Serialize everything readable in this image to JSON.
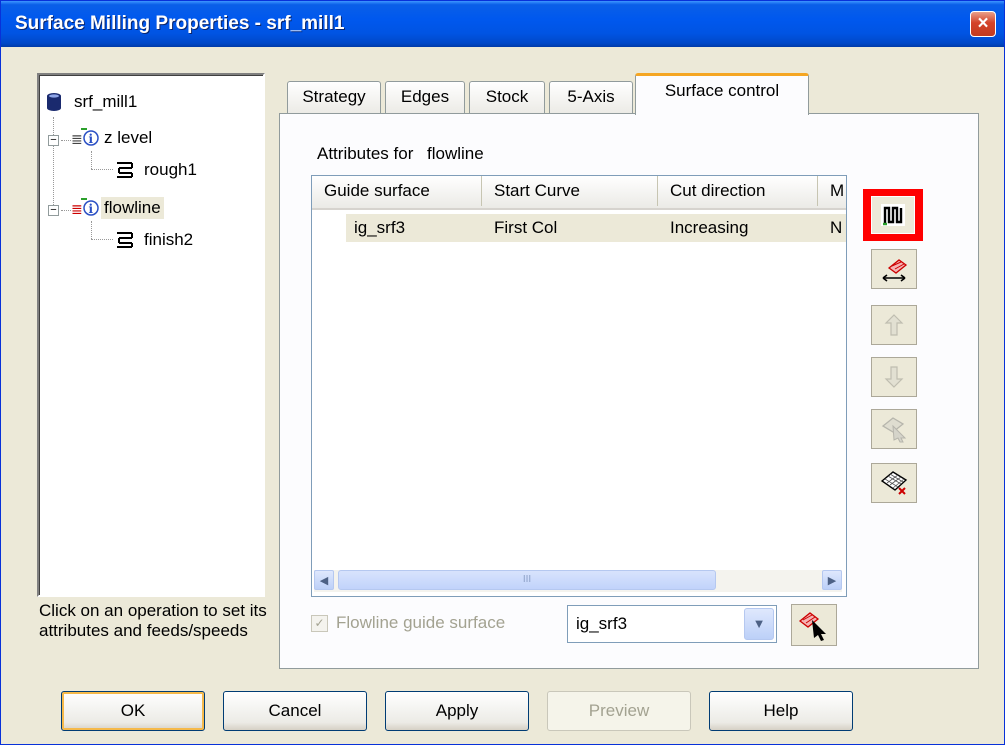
{
  "window": {
    "title": "Surface Milling Properties - srf_mill1",
    "close_glyph": "×"
  },
  "tree": {
    "root": "srf_mill1",
    "nodes": [
      {
        "label": "z level",
        "child": "rough1"
      },
      {
        "label": "flowline",
        "child": "finish2"
      }
    ]
  },
  "hint": "Click on an operation to set its attributes and feeds/speeds",
  "tabs": [
    "Strategy",
    "Edges",
    "Stock",
    "5-Axis",
    "Surface control"
  ],
  "active_tab": "Surface control",
  "attributes": {
    "label": "Attributes for",
    "value": "flowline"
  },
  "table": {
    "columns": [
      "Guide surface",
      "Start Curve",
      "Cut direction",
      "M"
    ],
    "rows": [
      [
        "ig_srf3",
        "First Col",
        "Increasing",
        "N"
      ]
    ]
  },
  "scrollbar": {
    "left": "◀",
    "right": "▶",
    "grip": "III"
  },
  "checkbox": {
    "label": "Flowline guide surface",
    "checked": true,
    "glyph": "✓"
  },
  "combo": {
    "value": "ig_srf3",
    "arrow": "▼"
  },
  "buttons": {
    "ok": "OK",
    "cancel": "Cancel",
    "apply": "Apply",
    "preview": "Preview",
    "help": "Help"
  },
  "colors": {
    "titlebar": "#0054e3",
    "face": "#ece9d8",
    "highlight": "#ff0000",
    "active_tab_accent": "#f5a623"
  },
  "icons": [
    "database-icon",
    "info-icon",
    "toolpath-icon",
    "columns-icon",
    "swap-direction-icon",
    "move-up-icon",
    "move-down-icon",
    "select-surface-icon",
    "grid-surface-icon",
    "pick-arrow-icon"
  ]
}
